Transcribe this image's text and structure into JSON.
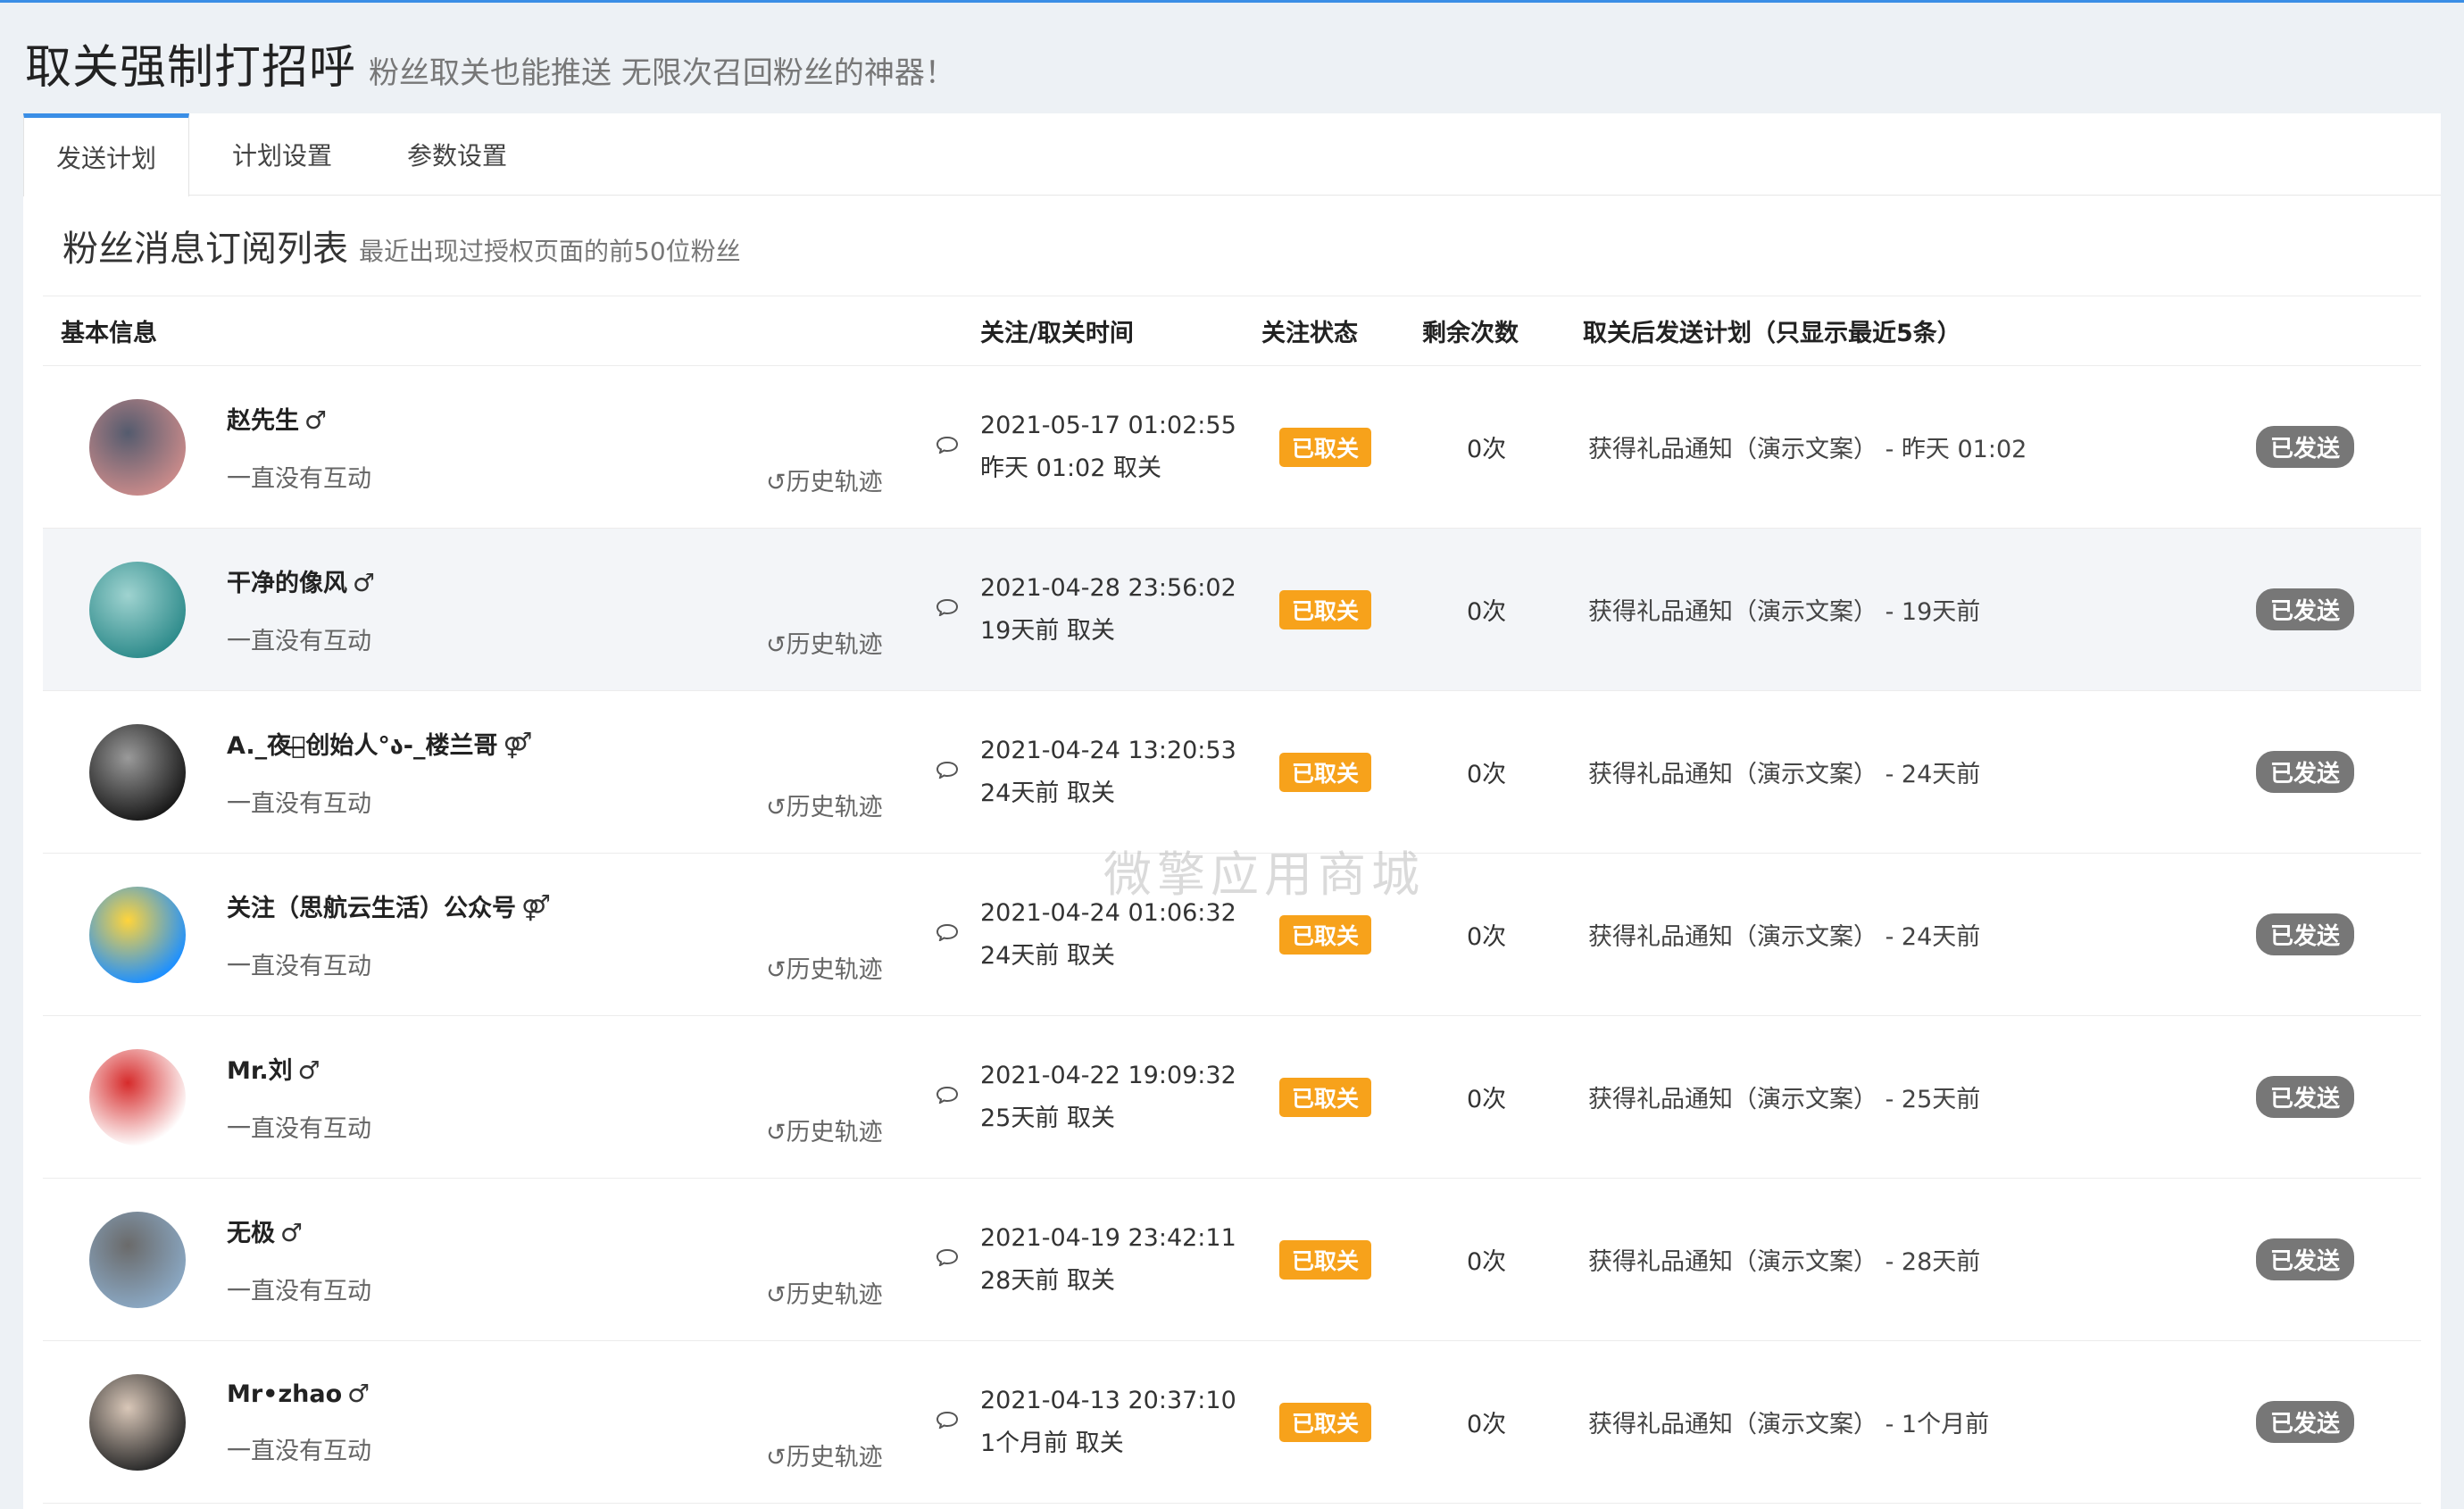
{
  "header": {
    "title": "取关强制打招呼",
    "subtitle": "粉丝取关也能推送 无限次召回粉丝的神器！"
  },
  "tabs": [
    {
      "label": "发送计划",
      "active": true
    },
    {
      "label": "计划设置",
      "active": false
    },
    {
      "label": "参数设置",
      "active": false
    }
  ],
  "section": {
    "title": "粉丝消息订阅列表",
    "subtitle": "最近出现过授权页面的前50位粉丝"
  },
  "columns": {
    "basic": "基本信息",
    "time": "关注/取关时间",
    "status": "关注状态",
    "count": "剩余次数",
    "plan": "取关后发送计划（只显示最近5条）"
  },
  "history_label": "历史轨迹",
  "watermark": "微擎应用商城",
  "rows": [
    {
      "nickname": "赵先生",
      "gender": "♂",
      "interaction": "一直没有互动",
      "follow_time": "2021-05-17 01:02:55",
      "unfollow": "昨天 01:02 取关",
      "status": "已取关",
      "count": "0次",
      "plan": "获得礼品通知（演示文案） - 昨天 01:02",
      "sent": "已发送",
      "avatar_colors": [
        "#c88a8a",
        "#545b6e"
      ]
    },
    {
      "nickname": "干净的像风",
      "gender": "♂",
      "interaction": "一直没有互动",
      "follow_time": "2021-04-28 23:56:02",
      "unfollow": "19天前 取关",
      "status": "已取关",
      "count": "0次",
      "plan": "获得礼品通知（演示文案） - 19天前",
      "sent": "已发送",
      "avatar_colors": [
        "#2f8c8c",
        "#9fd3d0"
      ]
    },
    {
      "nickname": "A._夜色̶创始人°ა-_楼兰哥",
      "gender": "⚤",
      "interaction": "一直没有互动",
      "follow_time": "2021-04-24 13:20:53",
      "unfollow": "24天前 取关",
      "status": "已取关",
      "count": "0次",
      "plan": "获得礼品通知（演示文案） - 24天前",
      "sent": "已发送",
      "avatar_colors": [
        "#1a1a1a",
        "#9a9a9a"
      ]
    },
    {
      "nickname": "关注（思航云生活）公众号",
      "gender": "⚤",
      "interaction": "一直没有互动",
      "follow_time": "2021-04-24 01:06:32",
      "unfollow": "24天前 取关",
      "status": "已取关",
      "count": "0次",
      "plan": "获得礼品通知（演示文案） - 24天前",
      "sent": "已发送",
      "avatar_colors": [
        "#1e90ff",
        "#ffd43b"
      ]
    },
    {
      "nickname": "Mr.刘",
      "gender": "♂",
      "interaction": "一直没有互动",
      "follow_time": "2021-04-22 19:09:32",
      "unfollow": "25天前 取关",
      "status": "已取关",
      "count": "0次",
      "plan": "获得礼品通知（演示文案） - 25天前",
      "sent": "已发送",
      "avatar_colors": [
        "#ffffff",
        "#d62b2b"
      ]
    },
    {
      "nickname": "无极",
      "gender": "♂",
      "interaction": "一直没有互动",
      "follow_time": "2021-04-19 23:42:11",
      "unfollow": "28天前 取关",
      "status": "已取关",
      "count": "0次",
      "plan": "获得礼品通知（演示文案） - 28天前",
      "sent": "已发送",
      "avatar_colors": [
        "#8aa7c2",
        "#6a6a6a"
      ]
    },
    {
      "nickname": "Mr•zhao",
      "gender": "♂",
      "interaction": "一直没有互动",
      "follow_time": "2021-04-13 20:37:10",
      "unfollow": "1个月前 取关",
      "status": "已取关",
      "count": "0次",
      "plan": "获得礼品通知（演示文案） - 1个月前",
      "sent": "已发送",
      "avatar_colors": [
        "#2b2b2b",
        "#d9c7b8"
      ]
    }
  ]
}
